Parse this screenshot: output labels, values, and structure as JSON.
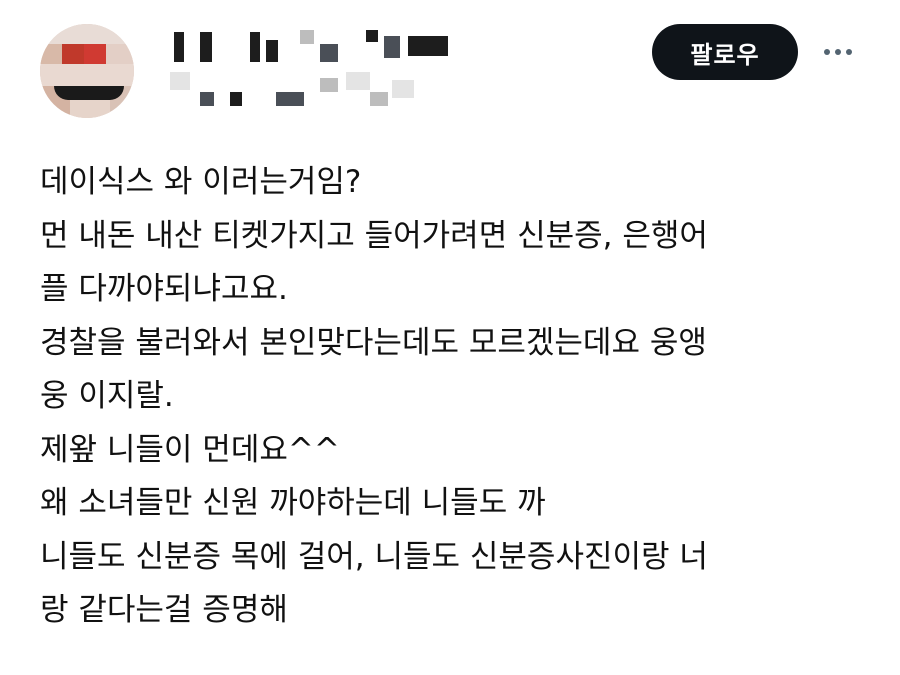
{
  "header": {
    "follow_label": "팔로우",
    "more_icon": "more-horizontal-icon"
  },
  "tweet": {
    "lines": [
      "데이식스 와 이러는거임?",
      "먼 내돈 내산 티켓가지고 들어가려면 신분증, 은행어",
      "플 다까야되냐고요.",
      "경찰을 불러와서 본인맞다는데도 모르겠는데요 웅앵",
      "웅 이지랄.",
      "제왚 니들이 먼데요^^",
      "왜 소녀들만 신원 까야하는데 니들도 까",
      "니들도 신분증 목에 걸어, 니들도 신분증사진이랑 너",
      "랑 같다는걸 증명해"
    ]
  },
  "colors": {
    "follow_button_bg": "#0f1419",
    "follow_button_text": "#ffffff",
    "text": "#111111",
    "more_dots": "#536471"
  }
}
